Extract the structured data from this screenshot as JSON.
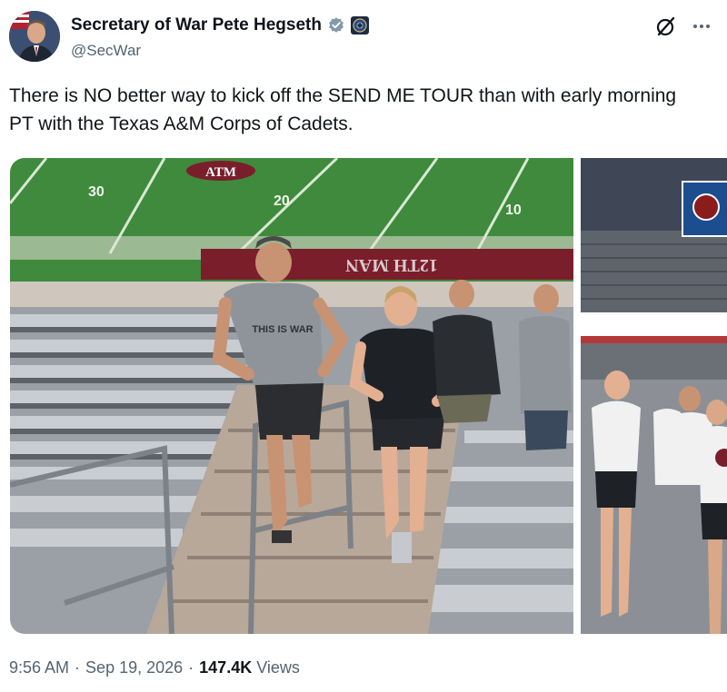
{
  "author": {
    "display_name": "Secretary of War Pete Hegseth",
    "handle": "@SecWar",
    "verified_color": "#829aab"
  },
  "icons": {
    "avatar": "profile-photo",
    "verified": "gray-check-badge-icon",
    "affiliation": "department-seal-icon",
    "grok": "grok-slash-icon",
    "more": "more-dots-icon"
  },
  "tweet": {
    "text": "There is NO better way to kick off the SEND ME TOUR than with early morning PT with the Texas A&M Corps of Cadets."
  },
  "media": {
    "photo1_shirt_text": "THIS IS WAR",
    "photo1_yard_left": "30",
    "photo1_yard_mid": "20",
    "photo1_yard_right": "10",
    "photo1_endzone_text": "12TH MAN"
  },
  "meta": {
    "time": "9:56 AM",
    "date": "Sep 19, 2026",
    "views_count": "147.4K",
    "views_label": "Views"
  }
}
